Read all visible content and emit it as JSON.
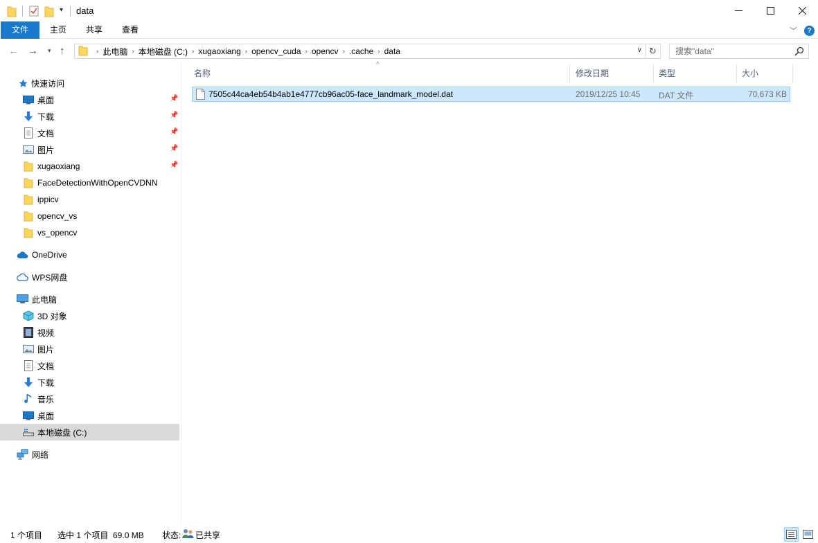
{
  "window": {
    "title": "data"
  },
  "ribbon": {
    "tabs": [
      "文件",
      "主页",
      "共享",
      "查看"
    ]
  },
  "address": {
    "crumbs": [
      "此电脑",
      "本地磁盘 (C:)",
      "xugaoxiang",
      "opencv_cuda",
      "opencv",
      ".cache",
      "data"
    ]
  },
  "search": {
    "placeholder": "搜索\"data\""
  },
  "sidebar": {
    "items": [
      {
        "label": "快速访问",
        "icon": "star-icon",
        "pinned": false
      },
      {
        "label": "桌面",
        "icon": "desktop-icon",
        "pinned": true
      },
      {
        "label": "下载",
        "icon": "download-icon",
        "pinned": true
      },
      {
        "label": "文档",
        "icon": "document-icon",
        "pinned": true
      },
      {
        "label": "图片",
        "icon": "pictures-icon",
        "pinned": true
      },
      {
        "label": "xugaoxiang",
        "icon": "folder-icon",
        "pinned": true
      },
      {
        "label": "FaceDetectionWithOpenCVDNN",
        "icon": "folder-icon",
        "pinned": false
      },
      {
        "label": "ippicv",
        "icon": "folder-icon",
        "pinned": false
      },
      {
        "label": "opencv_vs",
        "icon": "folder-icon",
        "pinned": false
      },
      {
        "label": "vs_opencv",
        "icon": "folder-icon",
        "pinned": false
      },
      {
        "label": "OneDrive",
        "icon": "cloud-icon",
        "pinned": false
      },
      {
        "label": "WPS网盘",
        "icon": "wps-cloud-icon",
        "pinned": false
      },
      {
        "label": "此电脑",
        "icon": "computer-icon",
        "pinned": false
      },
      {
        "label": "3D 对象",
        "icon": "3d-objects-icon",
        "pinned": false
      },
      {
        "label": "视频",
        "icon": "video-icon",
        "pinned": false
      },
      {
        "label": "图片",
        "icon": "pictures-icon",
        "pinned": false
      },
      {
        "label": "文档",
        "icon": "document-icon",
        "pinned": false
      },
      {
        "label": "下载",
        "icon": "download-icon",
        "pinned": false
      },
      {
        "label": "音乐",
        "icon": "music-icon",
        "pinned": false
      },
      {
        "label": "桌面",
        "icon": "desktop-icon",
        "pinned": false
      },
      {
        "label": "本地磁盘 (C:)",
        "icon": "drive-icon",
        "pinned": false,
        "selected": true
      },
      {
        "label": "网络",
        "icon": "network-icon",
        "pinned": false
      }
    ]
  },
  "columns": [
    "名称",
    "修改日期",
    "类型",
    "大小"
  ],
  "files": [
    {
      "name": "7505c44ca4eb54b4ab1e4777cb96ac05-face_landmark_model.dat",
      "modified": "2019/12/25 10:45",
      "type": "DAT 文件",
      "size": "70,673 KB",
      "selected": true
    }
  ],
  "status": {
    "count": "1 个项目",
    "selection": "选中 1 个项目  69.0 MB",
    "state_label": "状态:",
    "state_value": "已共享"
  },
  "colors": {
    "accent": "#1979ca",
    "selection": "#cce8ff",
    "selection_border": "#99d1ff",
    "header_text": "#4c607a",
    "meta_text": "#6d6d6d"
  }
}
